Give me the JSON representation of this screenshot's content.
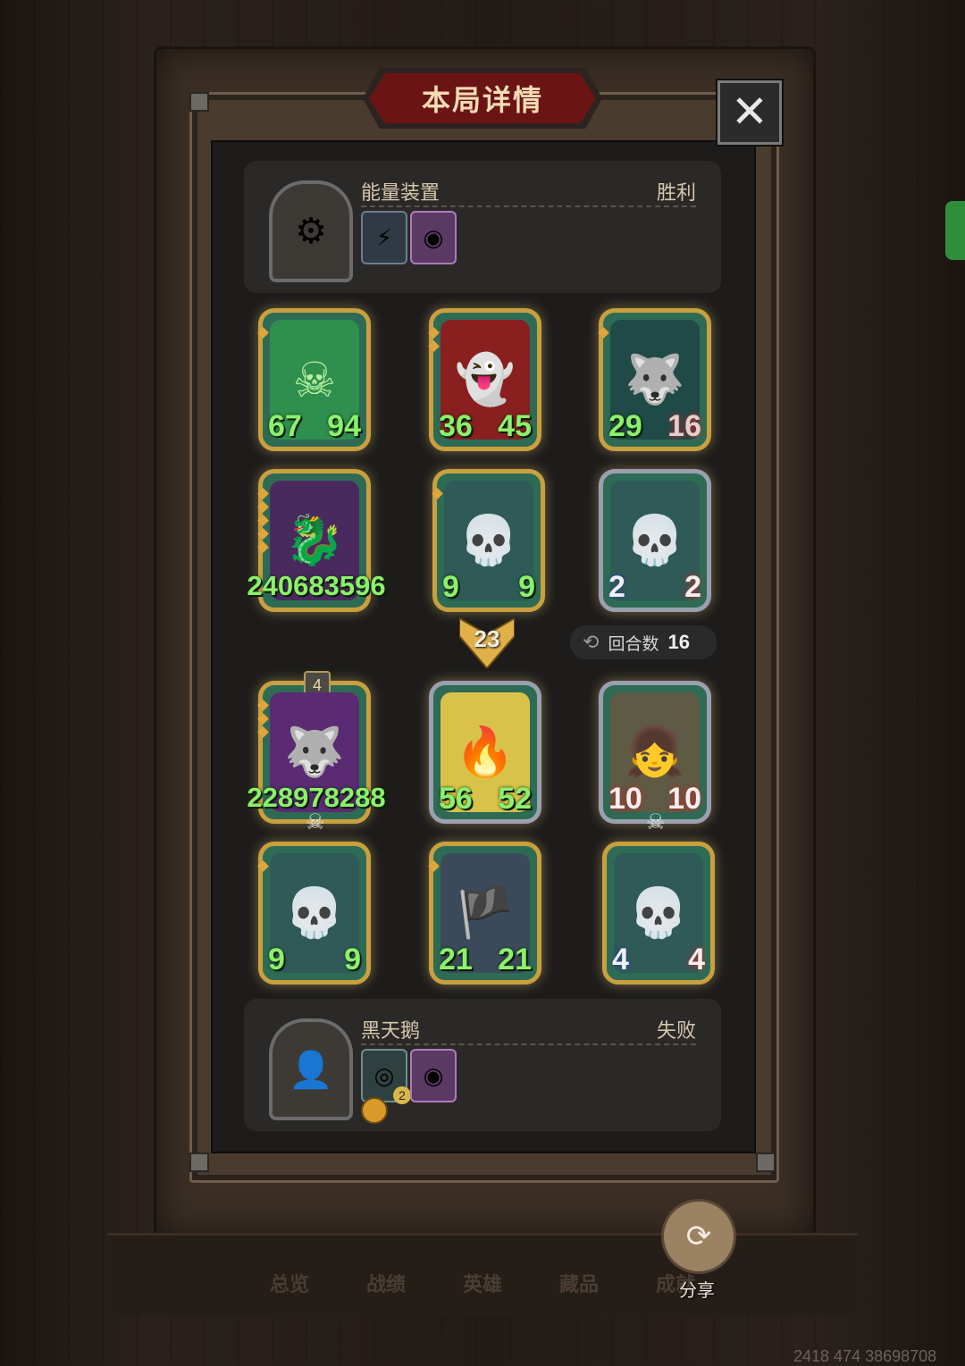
{
  "title": "本局详情",
  "close_icon": "✕",
  "player_top": {
    "name": "能量装置",
    "result": "胜利",
    "portrait_icon": "machine-portrait",
    "items": [
      "lightning-trinket",
      "gumball-machine"
    ]
  },
  "player_bottom": {
    "name": "黑天鹅",
    "result": "失败",
    "portrait_icon": "hooded-portrait",
    "items": [
      "radar-trinket",
      "gumball-machine",
      "coin-token"
    ],
    "item_count": "2"
  },
  "top_board": [
    {
      "attack": "67",
      "health": "94",
      "art": "green-warrior"
    },
    {
      "attack": "36",
      "health": "45",
      "art": "red-ghost"
    },
    {
      "attack": "29",
      "health": "16",
      "art": "spirit-wolf"
    },
    {
      "attack": "240683596",
      "health": "",
      "art": "dark-dragon"
    },
    {
      "attack": "9",
      "health": "9",
      "art": "skeleton"
    },
    {
      "attack": "2",
      "health": "2",
      "art": "skeleton"
    }
  ],
  "bottom_board": [
    {
      "attack": "228978288",
      "health": "",
      "art": "spirit-wolf",
      "badge": "4"
    },
    {
      "attack": "56",
      "health": "52",
      "art": "fire-brute"
    },
    {
      "attack": "10",
      "health": "10",
      "art": "ghost-girl"
    },
    {
      "attack": "9",
      "health": "9",
      "art": "skeleton"
    },
    {
      "attack": "21",
      "health": "21",
      "art": "pirate-captain"
    },
    {
      "attack": "4",
      "health": "4",
      "art": "skeleton"
    }
  ],
  "damage": "23",
  "rounds": {
    "label": "回合数",
    "value": "16"
  },
  "nav": [
    "总览",
    "战绩",
    "英雄",
    "藏品",
    "成就"
  ],
  "share_label": "分享",
  "footer_id": "2418 474 38698708"
}
